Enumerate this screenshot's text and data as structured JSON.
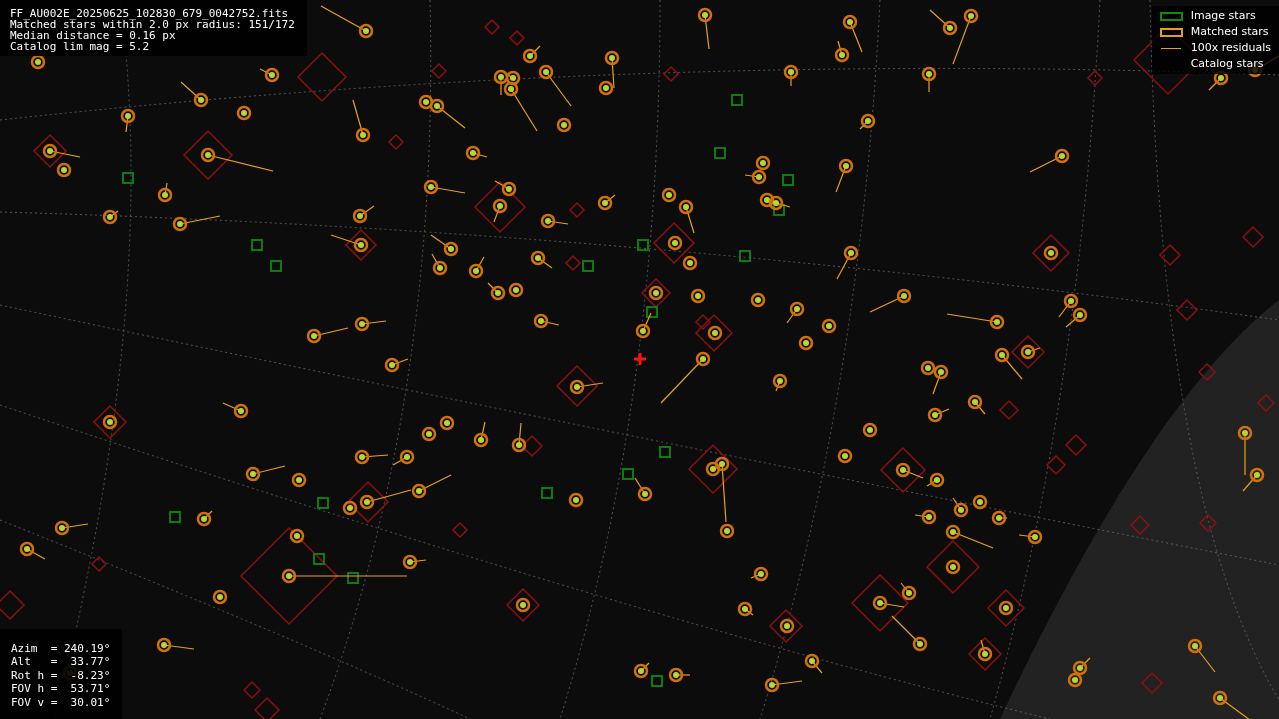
{
  "header": {
    "lines": [
      "FF_AU002E_20250625_102830_679_0042752.fits",
      "Matched stars within 2.0 px radius: 151/172",
      "Median distance = 0.16 px",
      "Catalog lim mag = 5.2"
    ]
  },
  "legend": [
    {
      "kind": "image",
      "label": "Image stars"
    },
    {
      "kind": "matched",
      "label": "Matched stars"
    },
    {
      "kind": "residual",
      "label": "100x residuals"
    },
    {
      "kind": "catalog",
      "label": "Catalog stars"
    }
  ],
  "pointing": {
    "lines": [
      "Azim  = 240.19°",
      "Alt   =  33.77°",
      "Rot h =  -8.23°",
      "FOV h =  53.71°",
      "FOV v =  30.01°"
    ]
  }
}
